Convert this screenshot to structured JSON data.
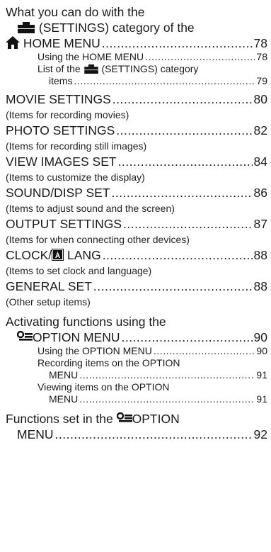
{
  "toc": {
    "settings_section": {
      "line1": "What you can do with the",
      "line2_text": "(SETTINGS) category of the",
      "line3_text": "HOME MENU",
      "line3_page": "78",
      "items": [
        {
          "text": "Using the HOME MENU",
          "page": "78"
        },
        {
          "text_a": "List of the",
          "text_b": "(SETTINGS) category",
          "text_c": "items",
          "page": "79"
        }
      ]
    },
    "entries": [
      {
        "title": "MOVIE SETTINGS",
        "page": "80",
        "desc": "(Items for recording movies)"
      },
      {
        "title": "PHOTO SETTINGS",
        "page": "82",
        "desc": "(Items for recording still images)"
      },
      {
        "title": "VIEW IMAGES SET",
        "page": "84",
        "desc": "(Items to customize the display)"
      },
      {
        "title": "SOUND/DISP SET",
        "page": "86",
        "desc": "(Items to adjust sound and the screen)"
      },
      {
        "title": "OUTPUT SETTINGS",
        "page": "87",
        "desc": "(Items for when connecting other devices)"
      },
      {
        "title_a": "CLOCK/",
        "title_b": "LANG",
        "page": "88",
        "desc": "(Items to set clock and language)"
      },
      {
        "title": "GENERAL SET",
        "page": "88",
        "desc": "(Other setup items)"
      }
    ],
    "option_section": {
      "line1": "Activating functions using the",
      "line2_text": "OPTION MENU",
      "line2_page": "90",
      "items": [
        {
          "text": "Using the OPTION MENU",
          "page": "90"
        },
        {
          "text_a": "Recording items on the OPTION",
          "text_b": "MENU",
          "page": "91"
        },
        {
          "text_a": "Viewing items on the OPTION",
          "text_b": "MENU",
          "page": "91"
        }
      ]
    },
    "functions_section": {
      "line1_text": "Functions set in the",
      "line1_text_b": "OPTION",
      "line2_text": "MENU",
      "line2_page": "92"
    }
  }
}
